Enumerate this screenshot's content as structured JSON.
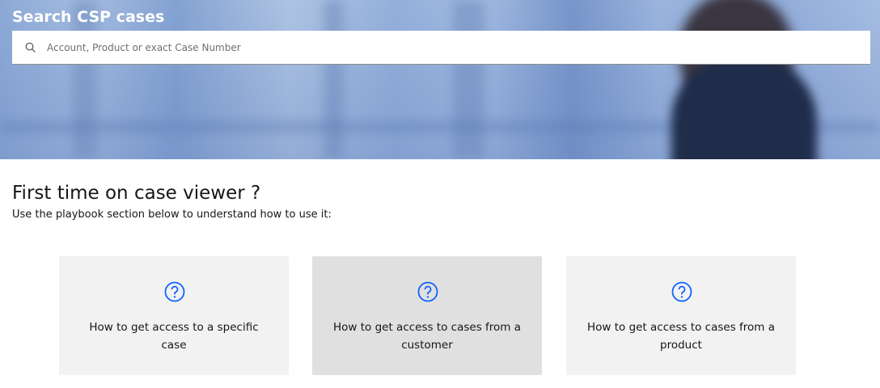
{
  "header": {
    "title": "Search CSP cases",
    "search_placeholder": "Account, Product or exact Case Number",
    "search_value": ""
  },
  "intro": {
    "heading": "First time on case viewer ?",
    "subtext": "Use the playbook section below to understand how to use it:"
  },
  "cards": [
    {
      "label": "How to get access to a specific case",
      "icon": "help-circle-icon"
    },
    {
      "label": "How to get access to cases from a customer",
      "icon": "help-circle-icon"
    },
    {
      "label": "How to get access to cases from a product",
      "icon": "help-circle-icon"
    }
  ],
  "colors": {
    "accent": "#0f62fe",
    "card_bg": "#f2f2f2",
    "card_hover_bg": "#e0e0e0"
  }
}
